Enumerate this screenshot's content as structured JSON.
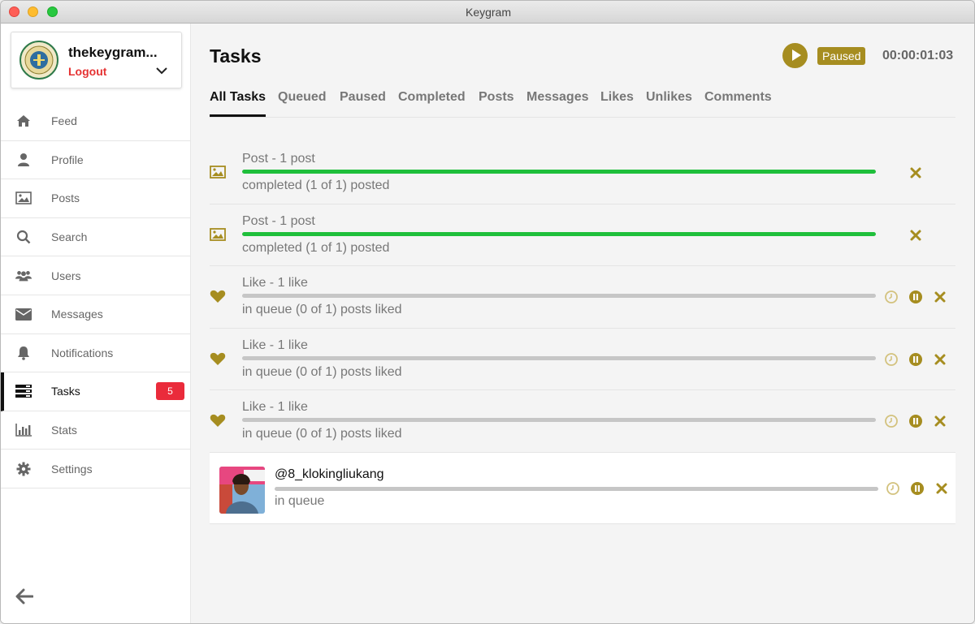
{
  "window": {
    "title": "Keygram"
  },
  "account": {
    "name": "thekeygram...",
    "logout_label": "Logout"
  },
  "nav": {
    "items": [
      {
        "label": "Feed",
        "icon": "home-icon"
      },
      {
        "label": "Profile",
        "icon": "user-icon"
      },
      {
        "label": "Posts",
        "icon": "image-icon"
      },
      {
        "label": "Search",
        "icon": "search-icon"
      },
      {
        "label": "Users",
        "icon": "users-icon"
      },
      {
        "label": "Messages",
        "icon": "envelope-icon"
      },
      {
        "label": "Notifications",
        "icon": "bell-icon"
      },
      {
        "label": "Tasks",
        "icon": "tasks-icon",
        "badge": "5",
        "active": true
      },
      {
        "label": "Stats",
        "icon": "bar-chart-icon"
      },
      {
        "label": "Settings",
        "icon": "gear-icon"
      }
    ]
  },
  "header": {
    "title": "Tasks",
    "status_label": "Paused",
    "timer": "00:00:01:03"
  },
  "tabs": [
    "All Tasks",
    "Queued",
    "Paused",
    "Completed",
    "Posts",
    "Messages",
    "Likes",
    "Unlikes",
    "Comments"
  ],
  "tasks": [
    {
      "type": "post",
      "icon": "image-icon",
      "title": "Post - 1 post",
      "status": "completed (1 of 1) posted",
      "progress": 1.0
    },
    {
      "type": "post",
      "icon": "image-icon",
      "title": "Post - 1 post",
      "status": "completed (1 of 1) posted",
      "progress": 1.0
    },
    {
      "type": "like",
      "icon": "heart-icon",
      "title": "Like - 1 like",
      "status": "in queue (0 of 1) posts liked",
      "progress": 0.0
    },
    {
      "type": "like",
      "icon": "heart-icon",
      "title": "Like - 1 like",
      "status": "in queue (0 of 1) posts liked",
      "progress": 0.0
    },
    {
      "type": "like",
      "icon": "heart-icon",
      "title": "Like - 1 like",
      "status": "in queue (0 of 1) posts liked",
      "progress": 0.0
    },
    {
      "type": "user",
      "icon": "avatar",
      "title": "@8_klokingliukang",
      "status": "in queue",
      "progress": 0.0
    }
  ],
  "colors": {
    "accent": "#a68d20",
    "progress_complete": "#1fbf3b",
    "badge": "#ea2b3b",
    "logout": "#e53232"
  }
}
